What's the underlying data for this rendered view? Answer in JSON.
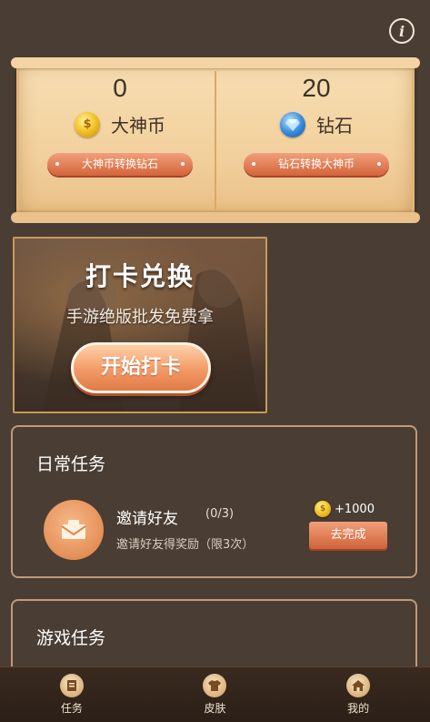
{
  "header": {
    "info_icon": "info-icon",
    "info_glyph": "i"
  },
  "wallet": {
    "coins": {
      "value": "0",
      "name": "大神币",
      "icon": "coin-icon",
      "convert_label": "大神币转换钻石"
    },
    "diamonds": {
      "value": "20",
      "name": "钻石",
      "icon": "diamond-icon",
      "convert_label": "钻石转换大神币"
    }
  },
  "banner": {
    "title": "打卡兑换",
    "subtitle": "手游绝版批发免费拿",
    "button_label": "开始打卡"
  },
  "daily_tasks": {
    "title": "日常任务",
    "items": [
      {
        "name": "邀请好友",
        "progress": "(0/3)",
        "description": "邀请好友得奖励（限3次）",
        "reward": "+1000",
        "action_label": "去完成",
        "icon": "envelope-icon"
      }
    ]
  },
  "game_tasks": {
    "title": "游戏任务"
  },
  "bottom_nav": {
    "items": [
      {
        "label": "任务",
        "icon": "task-icon"
      },
      {
        "label": "皮肤",
        "icon": "shirt-icon"
      },
      {
        "label": "我的",
        "icon": "home-icon"
      }
    ]
  },
  "colors": {
    "background": "#4a3d33",
    "accent": "#d4643c",
    "parchment": "#f2d09c"
  }
}
